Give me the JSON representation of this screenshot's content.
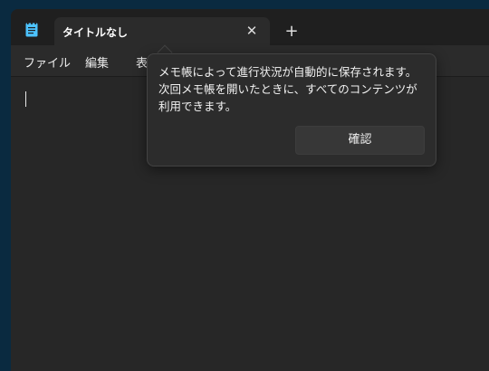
{
  "tab": {
    "title": "タイトルなし",
    "close_glyph": "✕"
  },
  "new_tab_glyph": "+",
  "menu": {
    "items": [
      "ファイル",
      "編集",
      "表"
    ]
  },
  "tooltip": {
    "message": "メモ帳によって進行状況が自動的に保存されます。次回メモ帳を開いたときに、すべてのコンテンツが利用できます。",
    "confirm_label": "確認"
  },
  "colors": {
    "desktop": "#0a2a40",
    "titlebar": "#1f1f1f",
    "surface": "#2b2b2b",
    "editor": "#272727",
    "app_icon": "#4cc2ff"
  }
}
